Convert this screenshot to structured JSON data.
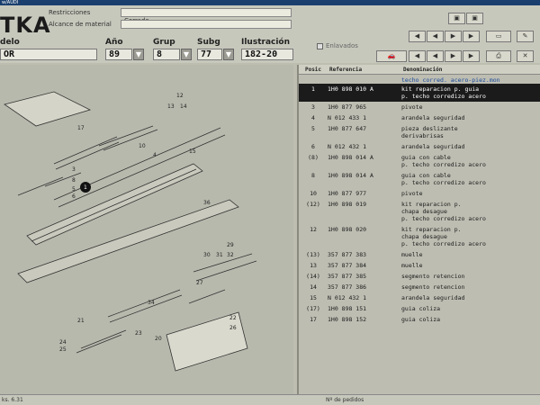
{
  "window": {
    "title": "w/AUDI"
  },
  "header": {
    "logo": "TKA",
    "restricciones_label": "Restricciones",
    "restricciones_value": "Corredo",
    "alcance_label": "Alcance de material",
    "model_label": "delo",
    "model_value": "OR",
    "ano_label": "Año",
    "ano_value": "89",
    "grup_label": "Grup",
    "grup_value": "8",
    "subg_label": "Subg",
    "subg_value": "77",
    "ilustracion_label": "Ilustración",
    "ilustracion_value": "182-20",
    "checkbox_label": "Enlavados"
  },
  "table": {
    "columns": [
      "Posic",
      "Referencia",
      "Denominación"
    ],
    "section_note": "techo corred. acero-piez.mon",
    "rows": [
      {
        "pos": "1",
        "ref": "1H0 898 010 A",
        "desc": "kit reparacion p. guia\np. techo corredizo acero",
        "selected": true
      },
      {
        "pos": "3",
        "ref": "1H0 877 965",
        "desc": "pivote"
      },
      {
        "pos": "4",
        "ref": "N  012 433 1",
        "desc": "arandela seguridad"
      },
      {
        "pos": "5",
        "ref": "1H0 877 647",
        "desc": "pieza deslizante\nderivabrisas"
      },
      {
        "pos": "6",
        "ref": "N  012 432 1",
        "desc": "arandela seguridad"
      },
      {
        "pos": "(8)",
        "ref": "1H0 898 014 A",
        "desc": "guia con cable\np. techo corredizo acero"
      },
      {
        "pos": "8",
        "ref": "1H0 898 014 A",
        "desc": "guia con cable\np. techo corredizo acero"
      },
      {
        "pos": "10",
        "ref": "1H0 877 977",
        "desc": "pivote"
      },
      {
        "pos": "(12)",
        "ref": "1H0 898 019",
        "desc": "kit reparacion p.\nchapa desague\np. techo corredizo acero"
      },
      {
        "pos": "12",
        "ref": "1H0 898 020",
        "desc": "kit reparacion p.\nchapa desague\np. techo corredizo acero"
      },
      {
        "pos": "(13)",
        "ref": "357 877 383",
        "desc": "muelle"
      },
      {
        "pos": "13",
        "ref": "357 877 384",
        "desc": "muelle"
      },
      {
        "pos": "(14)",
        "ref": "357 877 385",
        "desc": "segmento retencion"
      },
      {
        "pos": "14",
        "ref": "357 877 386",
        "desc": "segmento retencion"
      },
      {
        "pos": "15",
        "ref": "N  012 432 1",
        "desc": "arandela seguridad"
      },
      {
        "pos": "(17)",
        "ref": "1H0 898 151",
        "desc": "guia coliza"
      },
      {
        "pos": "17",
        "ref": "1H0 898 152",
        "desc": "guia coliza"
      }
    ]
  },
  "diagram": {
    "callouts": [
      "12",
      "13",
      "14",
      "15",
      "17",
      "4",
      "10",
      "3",
      "5",
      "6",
      "8",
      "1",
      "36",
      "29",
      "30",
      "31",
      "32",
      "34",
      "27",
      "22",
      "26",
      "21",
      "23",
      "24",
      "25",
      "20"
    ]
  },
  "statusbar": {
    "left": "ks. 6.31",
    "center": "Nº de pedidos"
  }
}
